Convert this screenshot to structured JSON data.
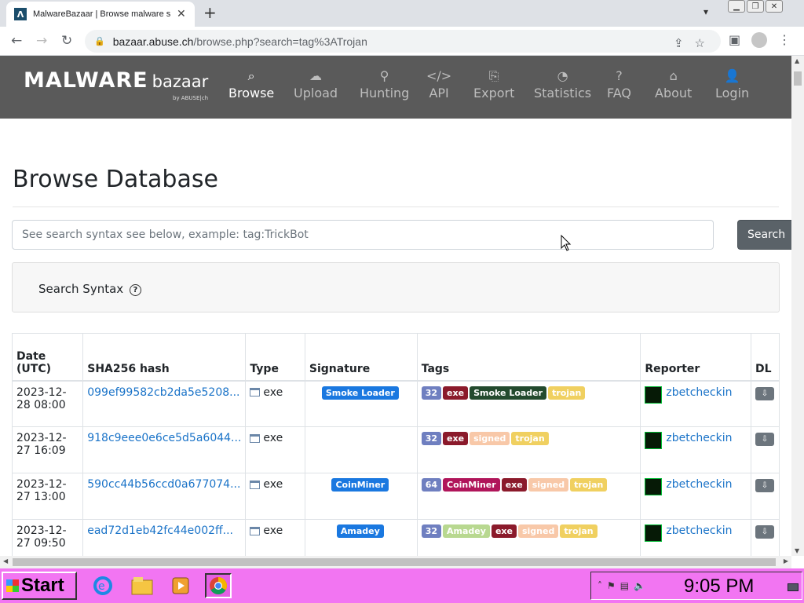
{
  "browser": {
    "tab_title": "MalwareBazaar | Browse malware s",
    "tab_favicon": "Λ",
    "url_host": "bazaar.abuse.ch",
    "url_path": "/browse.php?search=tag%3ATrojan"
  },
  "site": {
    "logo_main": "MALWARE",
    "logo_sub": "bazaar",
    "logo_by": "by ABUSE|ch",
    "nav": [
      {
        "label": "Browse",
        "icon": "search-icon",
        "active": true
      },
      {
        "label": "Upload",
        "icon": "cloud-upload-icon"
      },
      {
        "label": "Hunting",
        "icon": "binoculars-icon"
      },
      {
        "label": "API",
        "icon": "code-icon"
      },
      {
        "label": "Export",
        "icon": "file-export-icon"
      },
      {
        "label": "Statistics",
        "icon": "pie-chart-icon"
      },
      {
        "label": "FAQ",
        "icon": "question-icon"
      },
      {
        "label": "About",
        "icon": "building-icon"
      },
      {
        "label": "Login",
        "icon": "user-icon"
      }
    ]
  },
  "page": {
    "title": "Browse Database",
    "search_placeholder": "See search syntax see below, example: tag:TrickBot",
    "search_button": "Search",
    "syntax_label": "Search Syntax",
    "syntax_icon": "?"
  },
  "table": {
    "headers": {
      "date_1": "Date",
      "date_2": "(UTC)",
      "hash": "SHA256 hash",
      "type": "Type",
      "signature": "Signature",
      "tags": "Tags",
      "reporter": "Reporter",
      "dl": "DL"
    },
    "rows": [
      {
        "date_1": "2023-12-",
        "date_2": "28 08:00",
        "hash": "099ef99582cb2da5e5208...",
        "type": "exe",
        "signature": "Smoke Loader",
        "tags": [
          "32",
          "exe",
          "Smoke Loader",
          "trojan"
        ],
        "reporter": "zbetcheckin"
      },
      {
        "date_1": "2023-12-",
        "date_2": "27 16:09",
        "hash": "918c9eee0e6ce5d5a6044...",
        "type": "exe",
        "signature": "",
        "tags": [
          "32",
          "exe",
          "signed",
          "trojan"
        ],
        "reporter": "zbetcheckin"
      },
      {
        "date_1": "2023-12-",
        "date_2": "27 13:00",
        "hash": "590cc44b56ccd0a677074...",
        "type": "exe",
        "signature": "CoinMiner",
        "tags": [
          "64",
          "CoinMiner",
          "exe",
          "signed",
          "trojan"
        ],
        "reporter": "zbetcheckin"
      },
      {
        "date_1": "2023-12-",
        "date_2": "27 09:50",
        "hash": "ead72d1eb42fc44e002ff...",
        "type": "exe",
        "signature": "Amadey",
        "tags": [
          "32",
          "Amadey",
          "exe",
          "signed",
          "trojan"
        ],
        "reporter": "zbetcheckin"
      }
    ]
  },
  "colors": {
    "tag_32": "#6f7fc0",
    "tag_64": "#6f7fc0",
    "tag_exe": "#8b1a2b",
    "tag_smoke": "#234a2e",
    "tag_trojan": "#f0d060",
    "tag_signed": "#f8c8a8",
    "tag_coinminer": "#b0155a",
    "tag_amadey": "#b8d890",
    "sig_badge": "#1a78e0",
    "navbar": "#5a5a5a",
    "taskbar": "#f275f2"
  },
  "taskbar": {
    "start_label": "Start",
    "clock": "9:05 PM"
  }
}
